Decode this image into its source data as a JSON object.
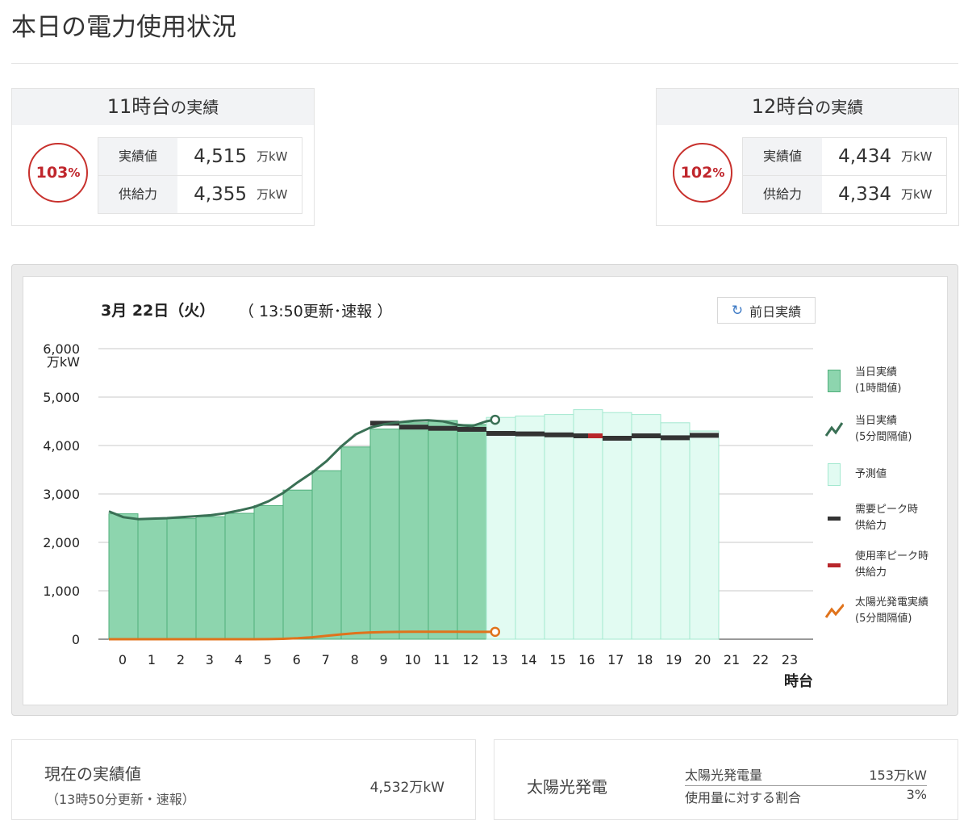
{
  "page": {
    "title": "本日の電力使用状況"
  },
  "hour_cards": [
    {
      "hour": "11時台",
      "suffix": "の実績",
      "pct_num": "103",
      "pct_sym": "%",
      "rows": [
        {
          "label": "実績値",
          "value": "4,515",
          "unit": "万kW"
        },
        {
          "label": "供給力",
          "value": "4,355",
          "unit": "万kW"
        }
      ]
    },
    {
      "hour": "12時台",
      "suffix": "の実績",
      "pct_num": "102",
      "pct_sym": "%",
      "rows": [
        {
          "label": "実績値",
          "value": "4,434",
          "unit": "万kW"
        },
        {
          "label": "供給力",
          "value": "4,334",
          "unit": "万kW"
        }
      ]
    }
  ],
  "chart_header": {
    "date": "3月 22日（火）",
    "update": "（ 13:50更新･速報 ）",
    "prev_day_button": "前日実績",
    "prev_day_icon": "refresh-icon"
  },
  "legend": [
    {
      "label": "当日実績\n(1時間値)",
      "icon": "green-bar"
    },
    {
      "label": "当日実績\n(5分間隔値)",
      "icon": "green-line"
    },
    {
      "label": "予測値",
      "icon": "mint-bar"
    },
    {
      "label": "需要ピーク時\n供給力",
      "icon": "black-dash"
    },
    {
      "label": "使用率ピーク時\n供給力",
      "icon": "red-dash"
    },
    {
      "label": "太陽光発電実績\n(5分間隔値)",
      "icon": "orange-line"
    }
  ],
  "colors": {
    "actual_bar": "#8dd5ae",
    "actual_bar_edge": "#4fae7b",
    "forecast_bar": "#e2fbf2",
    "forecast_bar_edge": "#a3e8cf",
    "demand_line": "#3a7055",
    "solar_line": "#e0731c",
    "peak_supply": "#333333",
    "usage_peak_supply": "#b8262a",
    "pct_red": "#c0262c"
  },
  "chart_data": {
    "type": "bar",
    "ylabel": "万kW",
    "xlabel": "時台",
    "ylim": [
      0,
      6000
    ],
    "y_ticks": [
      "0",
      "1,000",
      "2,000",
      "3,000",
      "4,000",
      "5,000",
      "6,000"
    ],
    "y_tick_values": [
      0,
      1000,
      2000,
      3000,
      4000,
      5000,
      6000
    ],
    "categories": [
      "0",
      "1",
      "2",
      "3",
      "4",
      "5",
      "6",
      "7",
      "8",
      "9",
      "10",
      "11",
      "12",
      "13",
      "14",
      "15",
      "16",
      "17",
      "18",
      "19",
      "20",
      "21",
      "22",
      "23"
    ],
    "grid": true,
    "legend_position": "right",
    "series": [
      {
        "name": "当日実績(1時間値)",
        "kind": "bar",
        "values": [
          2590,
          2480,
          2490,
          2530,
          2600,
          2760,
          3080,
          3480,
          3970,
          4340,
          4470,
          4515,
          4434,
          null,
          null,
          null,
          null,
          null,
          null,
          null,
          null,
          null,
          null,
          null
        ]
      },
      {
        "name": "予測値",
        "kind": "bar",
        "values": [
          null,
          null,
          null,
          null,
          null,
          null,
          null,
          null,
          null,
          null,
          null,
          null,
          null,
          4580,
          4610,
          4640,
          4740,
          4680,
          4640,
          4470,
          4300,
          null,
          null,
          null
        ]
      },
      {
        "name": "需要ピーク時供給力",
        "kind": "dash",
        "values": [
          null,
          null,
          null,
          null,
          null,
          null,
          null,
          null,
          null,
          4460,
          4380,
          4355,
          4334,
          4250,
          4240,
          4220,
          4200,
          4150,
          4200,
          4160,
          4210,
          null,
          null,
          null
        ]
      },
      {
        "name": "使用率ピーク時供給力",
        "kind": "dash",
        "values": [
          null,
          null,
          null,
          null,
          null,
          null,
          null,
          null,
          null,
          null,
          null,
          null,
          null,
          null,
          null,
          null,
          4200,
          null,
          null,
          null,
          null,
          null,
          null,
          null
        ]
      },
      {
        "name": "当日実績(5分間隔値)",
        "kind": "line",
        "x": [
          0,
          0.5,
          1,
          1.5,
          2,
          2.5,
          3,
          3.5,
          4,
          4.5,
          5,
          5.5,
          6,
          6.5,
          7,
          7.5,
          8,
          8.5,
          9,
          9.5,
          10,
          10.5,
          11,
          11.5,
          12,
          12.5,
          13,
          13.3
        ],
        "values": [
          2640,
          2520,
          2480,
          2490,
          2500,
          2520,
          2540,
          2560,
          2600,
          2660,
          2730,
          2850,
          3020,
          3240,
          3440,
          3680,
          3980,
          4230,
          4370,
          4440,
          4480,
          4510,
          4520,
          4500,
          4430,
          4400,
          4500,
          4532
        ]
      },
      {
        "name": "太陽光発電実績(5分間隔値)",
        "kind": "line",
        "x": [
          0,
          1,
          2,
          3,
          4,
          5,
          5.5,
          6,
          6.5,
          7,
          7.5,
          8,
          8.5,
          9,
          9.5,
          10,
          10.5,
          11,
          11.5,
          12,
          12.5,
          13,
          13.3
        ],
        "values": [
          0,
          0,
          0,
          0,
          0,
          0,
          2,
          8,
          20,
          40,
          70,
          100,
          125,
          140,
          148,
          152,
          154,
          155,
          155,
          154,
          153,
          153,
          153
        ]
      }
    ]
  },
  "current": {
    "title": "現在の実績値",
    "subtitle": "（13時50分更新・速報）",
    "value": "4,532万kW"
  },
  "solar": {
    "title": "太陽光発電",
    "rows": [
      {
        "label": "太陽光発電量",
        "value": "153万kW"
      },
      {
        "label": "使用量に対する割合",
        "value": "3%"
      }
    ]
  }
}
